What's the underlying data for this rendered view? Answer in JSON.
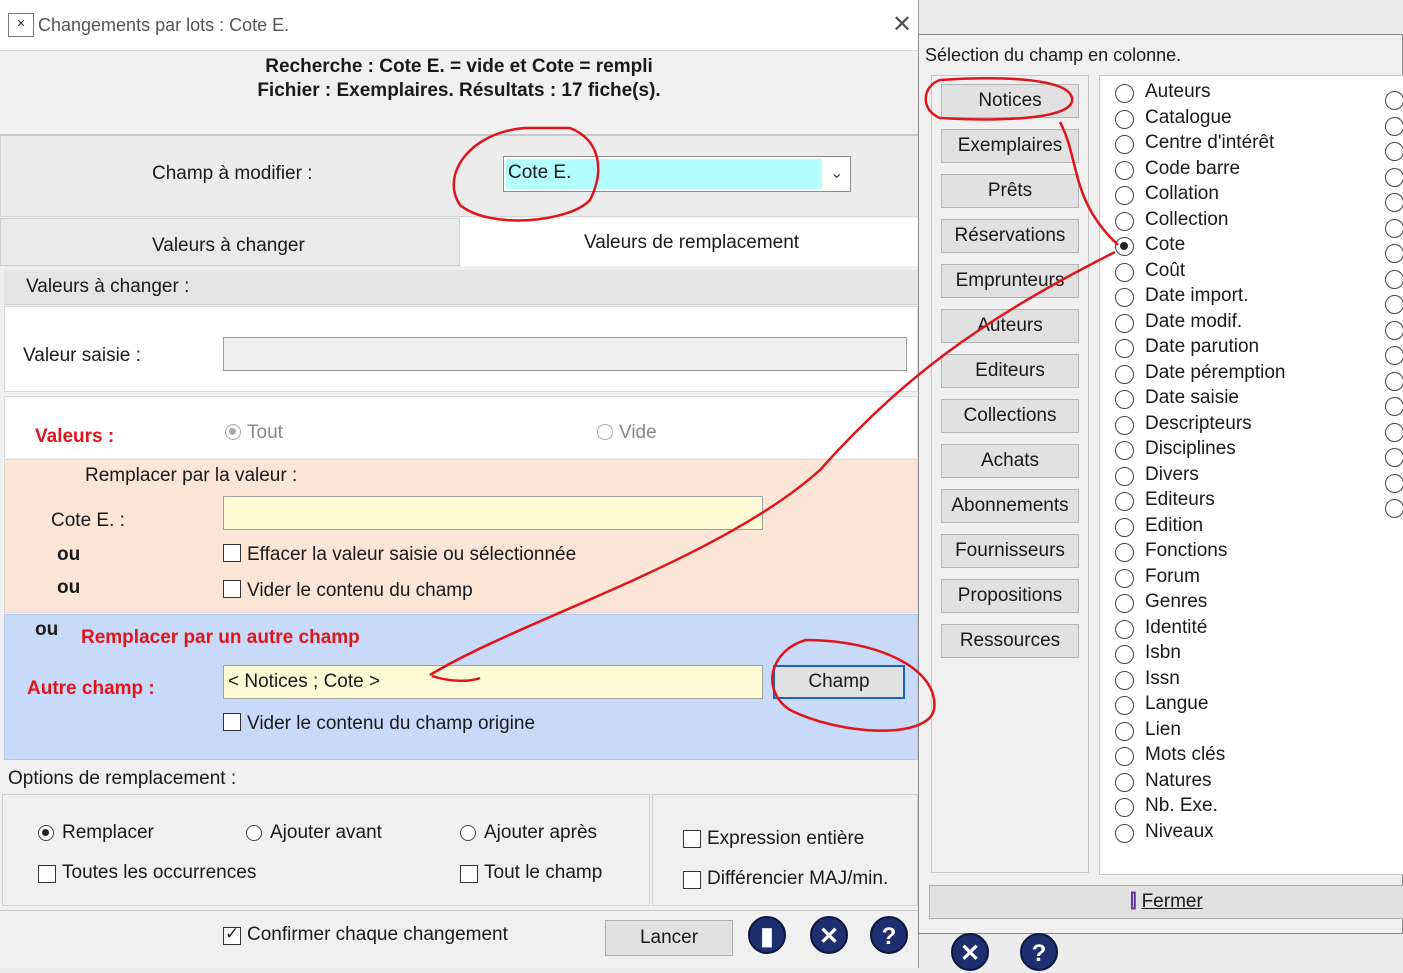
{
  "main": {
    "title": "Changements par lots : Cote E.",
    "header_line1": "Recherche : Cote E. = vide et Cote = rempli",
    "header_line2": "Fichier : Exemplaires. Résultats : 17 fiche(s).",
    "champ_label": "Champ à modifier :",
    "champ_value": "Cote E.",
    "tab_changer": "Valeurs à changer",
    "tab_remplacement": "Valeurs de remplacement",
    "section_valeurs_a_changer": "Valeurs à changer :",
    "valeur_saisie_label": "Valeur saisie :",
    "valeurs_label": "Valeurs :",
    "radio_tout": "Tout",
    "radio_vide": "Vide",
    "remplacer_par_valeur": "Remplacer par la valeur :",
    "cote_label": "Cote E. :",
    "ou": "ou",
    "effacer_label": "Effacer la valeur saisie ou sélectionnée",
    "vider_label": "Vider le contenu du champ",
    "remplacer_autre_champ": "Remplacer par un autre champ",
    "autre_champ_label": "Autre champ :",
    "autre_champ_value": "< Notices ; Cote >",
    "champ_button": "Champ",
    "vider_origine_label": "Vider le contenu du champ origine",
    "options_label": "Options de remplacement :",
    "opt_remplacer": "Remplacer",
    "opt_ajouter_avant": "Ajouter avant",
    "opt_ajouter_apres": "Ajouter après",
    "opt_toutes_occ": "Toutes les occurrences",
    "opt_tout_champ": "Tout le champ",
    "opt_expression": "Expression entière",
    "opt_differencier": "Différencier MAJ/min.",
    "confirmer_label": "Confirmer chaque changement",
    "lancer_button": "Lancer"
  },
  "selection": {
    "title": "Sélection du champ en colonne.",
    "buttons": [
      "Notices",
      "Exemplaires",
      "Prêts",
      "Réservations",
      "Emprunteurs",
      "Auteurs",
      "Editeurs",
      "Collections",
      "Achats",
      "Abonnements",
      "Fournisseurs",
      "Propositions",
      "Ressources"
    ],
    "fields": [
      "Auteurs",
      "Catalogue",
      "Centre d'intérêt",
      "Code barre",
      "Collation",
      "Collection",
      "Cote",
      "Coût",
      "Date import.",
      "Date modif.",
      "Date parution",
      "Date péremption",
      "Date saisie",
      "Descripteurs",
      "Disciplines",
      "Divers",
      "Editeurs",
      "Edition",
      "Fonctions",
      "Forum",
      "Genres",
      "Identité",
      "Isbn",
      "Issn",
      "Langue",
      "Lien",
      "Mots clés",
      "Natures",
      "Nb. Exe.",
      "Niveaux"
    ],
    "selected_field": "Cote",
    "fermer_button": "Fermer"
  },
  "colors": {
    "cyan_input": "#b3ffff",
    "peach": "#fbe5d6",
    "blue_panel": "#c9daf8",
    "annotation": "#e0151b"
  }
}
